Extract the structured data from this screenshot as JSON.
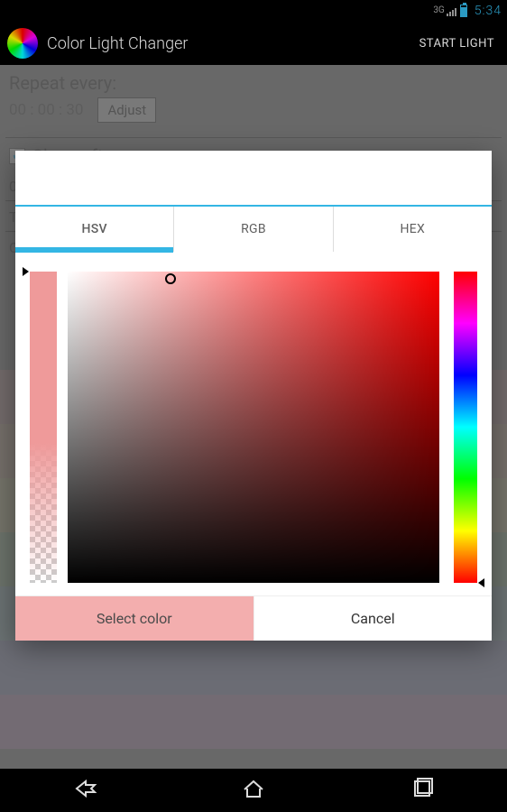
{
  "status": {
    "network_label": "3G",
    "clock": "5:34"
  },
  "actionbar": {
    "title": "Color Light Changer",
    "start_light": "START LIGHT"
  },
  "bg": {
    "repeat_label": "Repeat every:",
    "repeat_value": "00 : 00 : 30",
    "adjust": "Adjust",
    "sleep_label": "Sleep after:",
    "row3_leading": "0",
    "row4_leading": "T",
    "row5_leading": "C",
    "stripe_colors": [
      "#d7a0a0",
      "#e6c29a",
      "#e6e09a",
      "#a7dba0",
      "#9fd5d9",
      "#a0a8e0",
      "#d7a0d7"
    ]
  },
  "dialog": {
    "tabs": {
      "hsv": "HSV",
      "rgb": "RGB",
      "hex": "HEX",
      "active": "hsv"
    },
    "hsv_state": {
      "hue_deg": 0,
      "sat_pct": 30,
      "val_pct": 98,
      "alpha_pct": 100
    },
    "buttons": {
      "select": "Select color",
      "cancel": "Cancel"
    }
  }
}
